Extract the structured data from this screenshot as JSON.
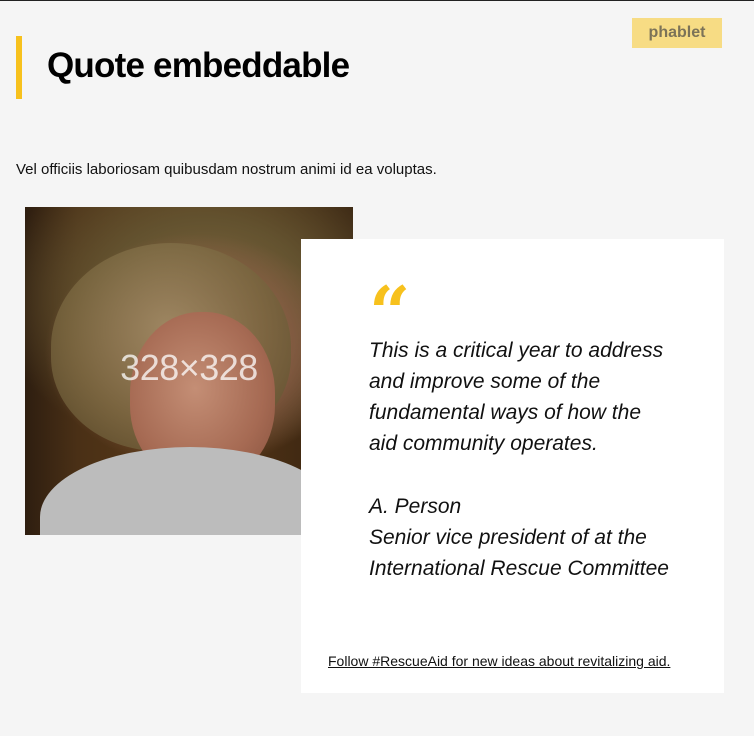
{
  "badge": {
    "label": "phablet"
  },
  "page": {
    "title": "Quote embeddable",
    "intro": "Vel officiis laboriosam quibusdam nostrum animi id ea voluptas."
  },
  "photo": {
    "placeholder_label": "328×328"
  },
  "quote": {
    "icon": "quote-mark-icon",
    "mark": "“",
    "text": "This is a critical year to address and improve some of the fundamental ways of how the aid community operates.",
    "attribution": {
      "name": "A. Person",
      "role": "Senior vice president of at the International Rescue Committee"
    },
    "link_text": "Follow #RescueAid for new ideas about revitalizing aid."
  },
  "colors": {
    "accent": "#f7c11d",
    "badge_bg": "#f7dc84",
    "badge_text": "#7c7358",
    "page_bg": "#f5f5f5",
    "card_bg": "#ffffff"
  }
}
